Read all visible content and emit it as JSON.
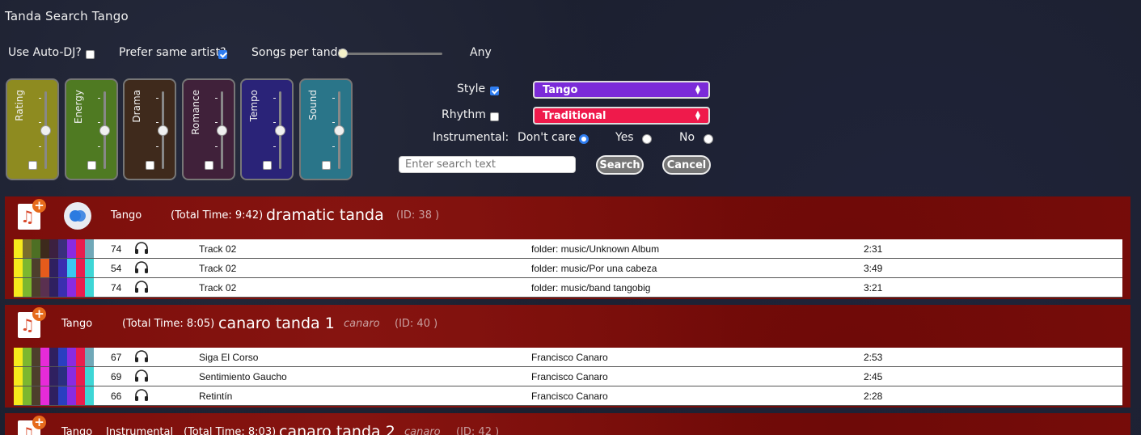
{
  "app": {
    "title": "Tanda Search Tango"
  },
  "options": {
    "auto_dj_label": "Use Auto-DJ?",
    "auto_dj_checked": false,
    "prefer_artist_label": "Prefer same artist?",
    "prefer_artist_checked": true,
    "songs_per_tanda_label": "Songs per tanda",
    "songs_per_tanda_value": "Any"
  },
  "mood_cards": [
    {
      "label": "Rating",
      "color": "#8e8b20"
    },
    {
      "label": "Energy",
      "color": "#4f7a22"
    },
    {
      "label": "Drama",
      "color": "#3f2a1c"
    },
    {
      "label": "Romance",
      "color": "#40213a"
    },
    {
      "label": "Tempo",
      "color": "#2a2378"
    },
    {
      "label": "Sound",
      "color": "#2a7589"
    }
  ],
  "filters": {
    "style_label": "Style",
    "style_checked": true,
    "style_value": "Tango",
    "style_color": "#7b2bd8",
    "rhythm_label": "Rhythm",
    "rhythm_checked": false,
    "rhythm_value": "Traditional",
    "rhythm_color": "#ef1a4b",
    "instrumental_label": "Instrumental:",
    "instrumental_options": [
      "Don't care",
      "Yes",
      "No"
    ],
    "instrumental_selected": "Don't care",
    "search_placeholder": "Enter search text",
    "search_button": "Search",
    "cancel_button": "Cancel"
  },
  "tandas": [
    {
      "style": "Tango",
      "instrumental": "",
      "total_time": "(Total Time: 9:42)",
      "name": "dramatic tanda",
      "artist": "",
      "id": "(ID: 38 )",
      "tracks": [
        {
          "rating": "74",
          "title": "Track 02",
          "artist": "folder: music/Unknown Album",
          "duration": "2:31"
        },
        {
          "rating": "54",
          "title": "Track 02",
          "artist": "folder: music/Por una cabeza",
          "duration": "3:49"
        },
        {
          "rating": "74",
          "title": "Track 02",
          "artist": "folder: music/band tangobig",
          "duration": "3:21"
        }
      ]
    },
    {
      "style": "Tango",
      "instrumental": "",
      "total_time": "(Total Time: 8:05)",
      "name": "canaro tanda 1",
      "artist": "canaro",
      "id": "(ID: 40 )",
      "tracks": [
        {
          "rating": "67",
          "title": "Siga El Corso",
          "artist": "Francisco Canaro",
          "duration": "2:53"
        },
        {
          "rating": "69",
          "title": "Sentimiento Gaucho",
          "artist": "Francisco Canaro",
          "duration": "2:45"
        },
        {
          "rating": "66",
          "title": "Retintín",
          "artist": "Francisco Canaro",
          "duration": "2:28"
        }
      ]
    },
    {
      "style": "Tango",
      "instrumental": "Instrumental",
      "total_time": "(Total Time: 8:03)",
      "name": "canaro tanda 2",
      "artist": "canaro",
      "id": "(ID: 42 )",
      "tracks": []
    }
  ]
}
